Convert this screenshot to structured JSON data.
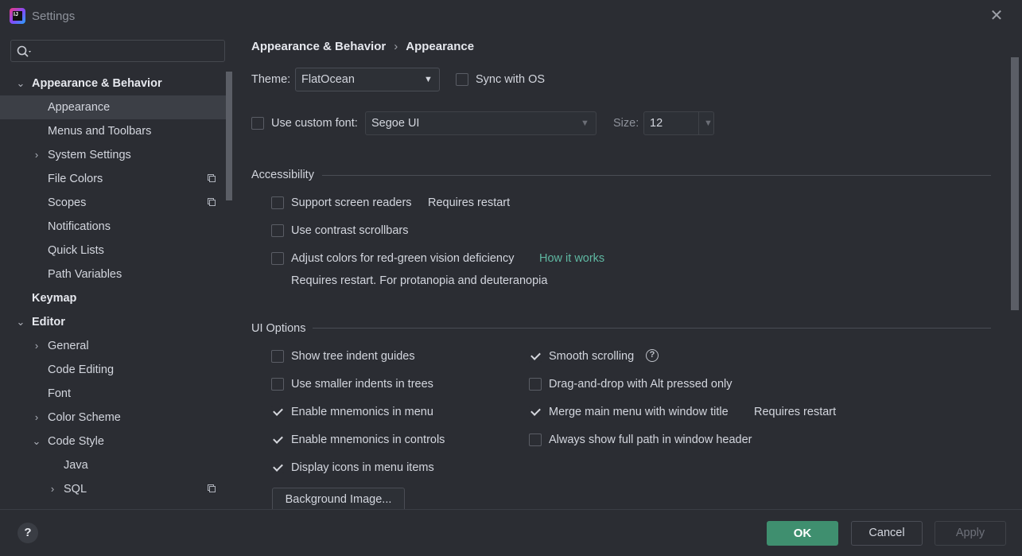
{
  "window": {
    "title": "Settings",
    "close_icon": "close-icon"
  },
  "sidebar": {
    "search": {
      "value": "",
      "placeholder": ""
    },
    "items": [
      {
        "label": "Appearance & Behavior",
        "expanded": true,
        "bold": true
      },
      {
        "label": "Appearance",
        "selected": true
      },
      {
        "label": "Menus and Toolbars"
      },
      {
        "label": "System Settings",
        "expandable": true
      },
      {
        "label": "File Colors",
        "copy_icon": true
      },
      {
        "label": "Scopes",
        "copy_icon": true
      },
      {
        "label": "Notifications"
      },
      {
        "label": "Quick Lists"
      },
      {
        "label": "Path Variables"
      },
      {
        "label": "Keymap",
        "bold": true
      },
      {
        "label": "Editor",
        "expanded": true,
        "bold": true
      },
      {
        "label": "General",
        "expandable": true
      },
      {
        "label": "Code Editing"
      },
      {
        "label": "Font"
      },
      {
        "label": "Color Scheme",
        "expandable": true
      },
      {
        "label": "Code Style",
        "expanded": true
      },
      {
        "label": "Java"
      },
      {
        "label": "SQL",
        "expandable": true,
        "copy_icon": true
      }
    ]
  },
  "breadcrumb": {
    "parent": "Appearance & Behavior",
    "separator": "›",
    "current": "Appearance"
  },
  "theme": {
    "label": "Theme:",
    "value": "FlatOcean",
    "sync_label": "Sync with OS",
    "sync_checked": false
  },
  "font": {
    "checkbox_label": "Use custom font:",
    "checked": false,
    "value": "Segoe UI",
    "size_label": "Size:",
    "size_value": "12"
  },
  "accessibility": {
    "title": "Accessibility",
    "screen_readers_label": "Support screen readers",
    "screen_readers_note": "Requires restart",
    "contrast_scrollbars_label": "Use contrast scrollbars",
    "color_deficiency_label": "Adjust colors for red-green vision deficiency",
    "how_it_works": "How it works",
    "color_deficiency_note": "Requires restart. For protanopia and deuteranopia"
  },
  "ui_options": {
    "title": "UI Options",
    "left": [
      {
        "label": "Show tree indent guides",
        "checked": false
      },
      {
        "label": "Use smaller indents in trees",
        "checked": false
      },
      {
        "label": "Enable mnemonics in menu",
        "checked": true
      },
      {
        "label": "Enable mnemonics in controls",
        "checked": true
      },
      {
        "label": "Display icons in menu items",
        "checked": true
      }
    ],
    "right": [
      {
        "label": "Smooth scrolling",
        "checked": true
      },
      {
        "label": "Drag-and-drop with Alt pressed only",
        "checked": false
      },
      {
        "label": "Merge main menu with window title",
        "checked": true
      },
      {
        "label": "Always show full path in window header",
        "checked": false
      }
    ],
    "merge_note": "Requires restart",
    "background_button": "Background Image..."
  },
  "footer": {
    "help": "?",
    "ok": "OK",
    "cancel": "Cancel",
    "apply": "Apply"
  },
  "colors": {
    "accent": "#3f8f6f",
    "link": "#5fb8a2",
    "background": "#2b2d33"
  }
}
